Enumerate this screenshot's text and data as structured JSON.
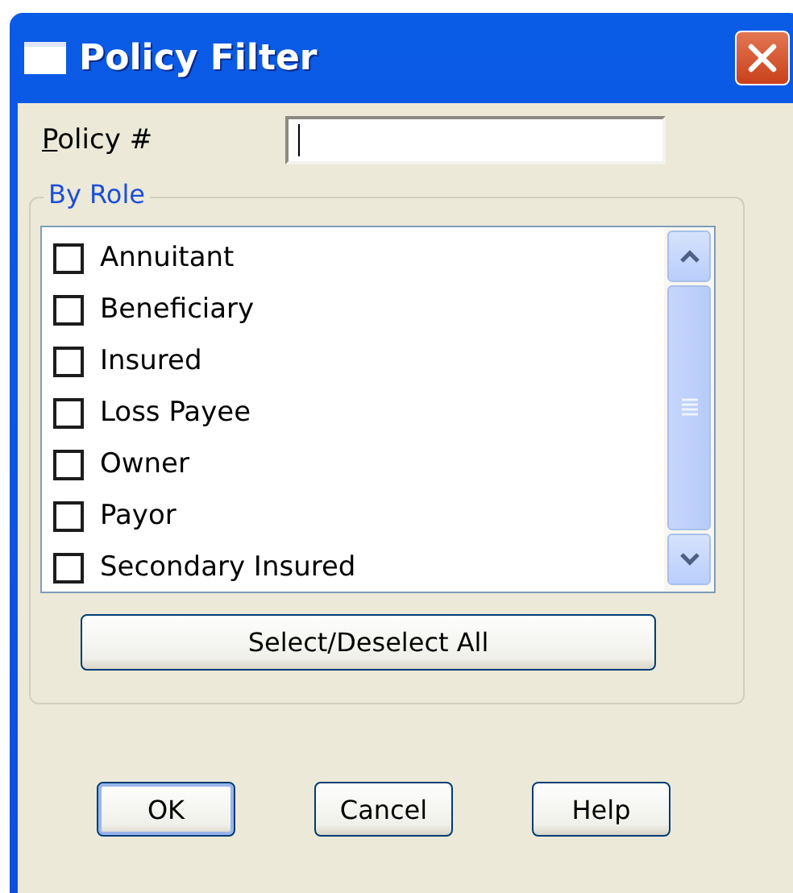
{
  "window": {
    "title": "Policy Filter"
  },
  "policy_field": {
    "label": "Policy #",
    "focused": true
  },
  "role_group": {
    "title": "By Role",
    "roles": [
      {
        "label": "Annuitant",
        "checked": false
      },
      {
        "label": "Beneficiary",
        "checked": false
      },
      {
        "label": "Insured",
        "checked": false
      },
      {
        "label": "Loss Payee",
        "checked": false
      },
      {
        "label": "Owner",
        "checked": false
      },
      {
        "label": "Payor",
        "checked": false
      },
      {
        "label": "Secondary Insured",
        "checked": false
      }
    ],
    "select_all_button": "Select/Deselect All"
  },
  "buttons": [
    {
      "label": "OK",
      "default": true
    },
    {
      "label": "Cancel",
      "default": false
    },
    {
      "label": "Help",
      "default": false
    }
  ]
}
